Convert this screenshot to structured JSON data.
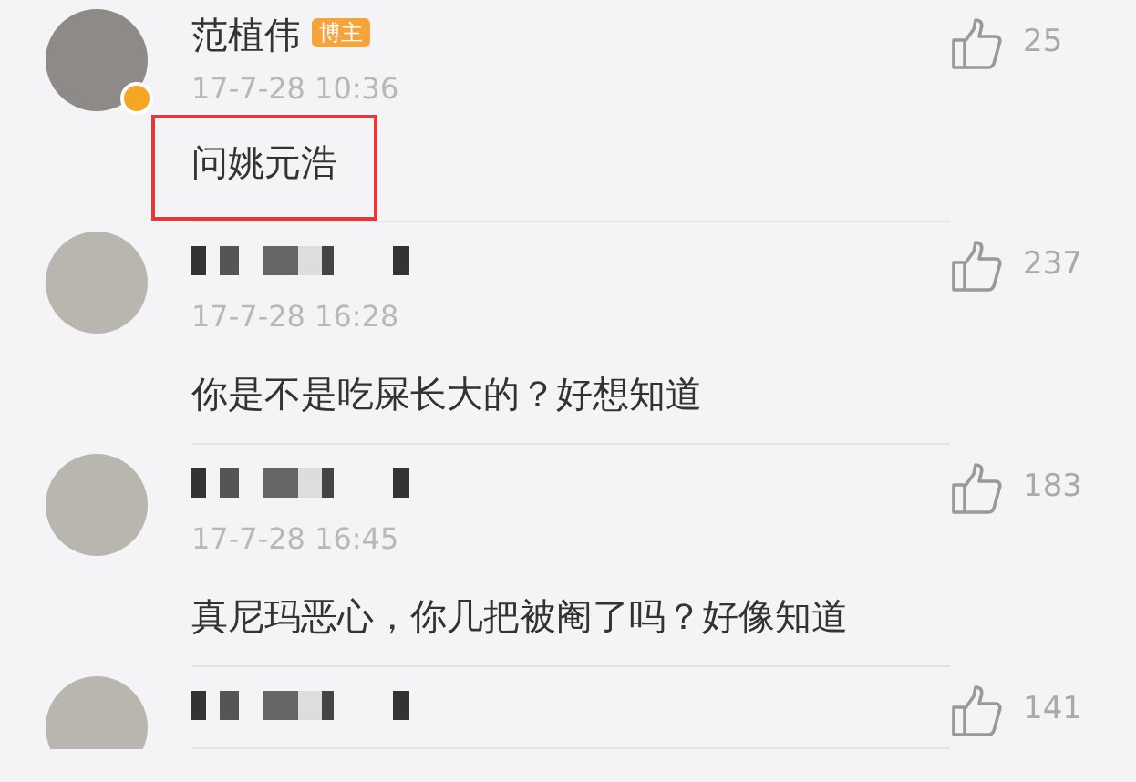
{
  "comments": [
    {
      "kind": "named",
      "name": "范植伟",
      "badge": "博主",
      "verified": true,
      "time": "17-7-28 10:36",
      "text": "问姚元浩",
      "likes": "25",
      "highlighted": true
    },
    {
      "kind": "blurred",
      "time": "17-7-28 16:28",
      "text": "你是不是吃屎长大的？好想知道",
      "likes": "237",
      "highlighted": false
    },
    {
      "kind": "blurred",
      "time": "17-7-28 16:45",
      "text": "真尼玛恶心，你几把被阉了吗？好像知道",
      "likes": "183",
      "highlighted": false
    },
    {
      "kind": "blurred",
      "likes": "141"
    }
  ]
}
